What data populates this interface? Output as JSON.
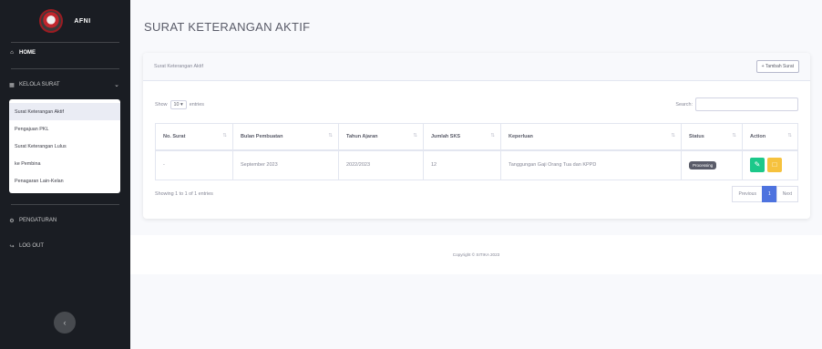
{
  "sidebar": {
    "brand": "AFNI",
    "home": "HOME",
    "kelola": "KELOLA SURAT",
    "submenu": [
      "Surat Keterangan Aktif",
      "Pengajuan PKL",
      "Surat Keterangan Lulus",
      "ke Pembina",
      "Penagaran Lain-Kelan"
    ],
    "pengaturan": "PENGATURAN",
    "logout": "LOG OUT"
  },
  "page": {
    "title": "SURAT KETERANGAN AKTIF",
    "card_title": "Surat Keterangan Aktif",
    "add_button": "+ Tambah Surat",
    "show_label": "Show",
    "length_value": "10",
    "entries_label": "entries",
    "search_label": "Search:",
    "columns": [
      "No. Surat",
      "Bulan Pembuatan",
      "Tahun Ajaran",
      "Jumlah SKS",
      "Keperluan",
      "Status",
      "Action"
    ],
    "rows": [
      [
        "-",
        "September 2023",
        "2022/2023",
        "12",
        "Tanggungan Gaji Orang Tua dan KPPD",
        "Processing"
      ]
    ],
    "info": "Showing 1 to 1 of 1 entries",
    "pager": {
      "prev": "Previous",
      "current": "1",
      "next": "Next"
    },
    "footer": "Copyright © SITIKA 2023"
  },
  "colors": {
    "primary": "#4e73df",
    "success": "#1cc88a",
    "warning": "#f6c23e",
    "sidebar": "#1a1d23"
  }
}
